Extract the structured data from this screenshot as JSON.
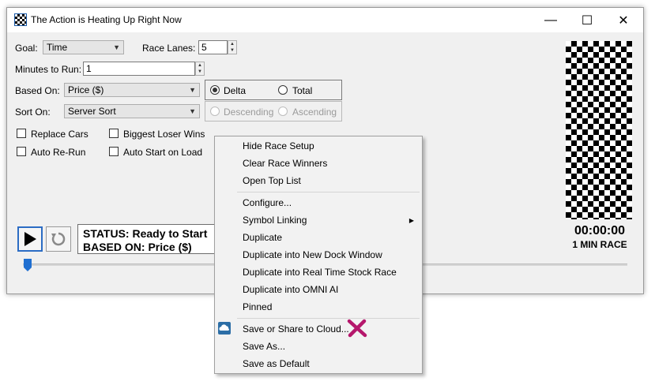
{
  "window": {
    "title": "The Action is Heating Up Right Now",
    "minimize": "—",
    "maximize": "☐",
    "close": "✕"
  },
  "form": {
    "goal_label": "Goal:",
    "goal_value": "Time",
    "race_lanes_label": "Race Lanes:",
    "race_lanes_value": "5",
    "minutes_label": "Minutes to Run:",
    "minutes_value": "1",
    "based_on_label": "Based On:",
    "based_on_value": "Price ($)",
    "sort_on_label": "Sort On:",
    "sort_on_value": "Server Sort",
    "delta_label": "Delta",
    "total_label": "Total",
    "descending_label": "Descending",
    "ascending_label": "Ascending",
    "replace_cars_label": "Replace Cars",
    "biggest_loser_label": "Biggest Loser Wins",
    "auto_rerun_label": "Auto Re-Run",
    "auto_start_label": "Auto Start on Load"
  },
  "status": {
    "line1": "STATUS: Ready to Start",
    "line2": "BASED ON: Price ($)"
  },
  "race": {
    "timer": "00:00:00",
    "label": "1 MIN RACE"
  },
  "context_menu": {
    "items": [
      "Hide Race Setup",
      "Clear Race Winners",
      "Open Top List",
      "Configure...",
      "Symbol Linking",
      "Duplicate",
      "Duplicate into New Dock Window",
      "Duplicate into Real Time Stock Race",
      "Duplicate into OMNI AI",
      "Pinned",
      "Save or Share to Cloud...",
      "Save As...",
      "Save as Default"
    ]
  },
  "colors": {
    "accent_blue": "#2b6cc4",
    "annotation_x": "#b5176c"
  }
}
